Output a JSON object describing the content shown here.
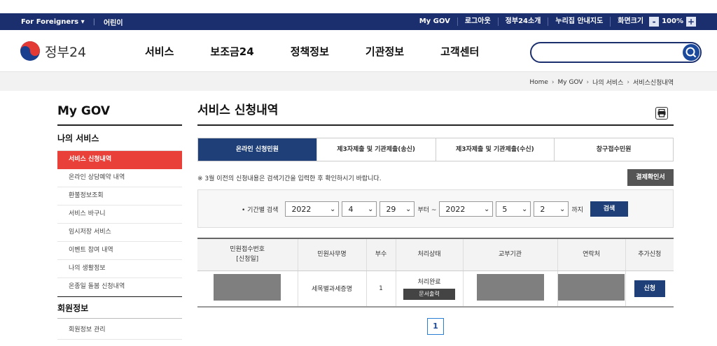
{
  "topbar": {
    "foreigners": "For Foreigners",
    "kids": "어린이",
    "links": [
      "My GOV",
      "로그아웃",
      "정부24소개",
      "누리집 안내지도",
      "화면크기"
    ],
    "zoom_minus": "-",
    "zoom_value": "100%",
    "zoom_plus": "+"
  },
  "header": {
    "logo_text": "정부24",
    "gnb": [
      "서비스",
      "보조금24",
      "정책정보",
      "기관정보",
      "고객센터"
    ],
    "search_placeholder": "",
    "brand_colors": {
      "navy": "#1b2f6e",
      "red": "#e9403a",
      "blue": "#1e3f77"
    }
  },
  "breadcrumb": [
    "Home",
    "My GOV",
    "나의 서비스",
    "서비스신청내역"
  ],
  "sidebar": {
    "title": "My GOV",
    "group1": "나의 서비스",
    "items": [
      "서비스 신청내역",
      "온라인 상담예약 내역",
      "환불정보조회",
      "서비스 바구니",
      "임시저장 서비스",
      "이벤트 참여 내역",
      "나의 생활정보",
      "온종일 돌봄 신청내역"
    ],
    "active_index": 0,
    "group2": "회원정보",
    "items2": [
      "회원정보 관리"
    ]
  },
  "main": {
    "title": "서비스 신청내역",
    "tabs": [
      "온라인 신청민원",
      "제3자제출 및 기관제출(송신)",
      "제3자제출 및 기관제출(수신)",
      "창구접수민원"
    ],
    "active_tab": 0,
    "notice": "※ 3월 이전의 신청내용은 검색기간을 입력한 후 확인하시기 바랍니다.",
    "receipt_button": "결제확인서",
    "filter": {
      "label": "• 기간별 검색",
      "from_year": "2022",
      "from_month": "4",
      "from_day": "29",
      "from_suffix": "부터 ~",
      "to_year": "2022",
      "to_month": "5",
      "to_day": "2",
      "to_suffix": "까지",
      "search_button": "검색"
    },
    "table": {
      "headers": [
        "민원접수번호",
        "[신청일]",
        "민원사무명",
        "부수",
        "처리상태",
        "교부기관",
        "연락처",
        "추가신청"
      ],
      "row": {
        "service_name": "세목별과세증명",
        "copies": "1",
        "status": "처리완료",
        "doc_button": "문서출력",
        "apply_button": "신청"
      }
    },
    "page": "1"
  }
}
